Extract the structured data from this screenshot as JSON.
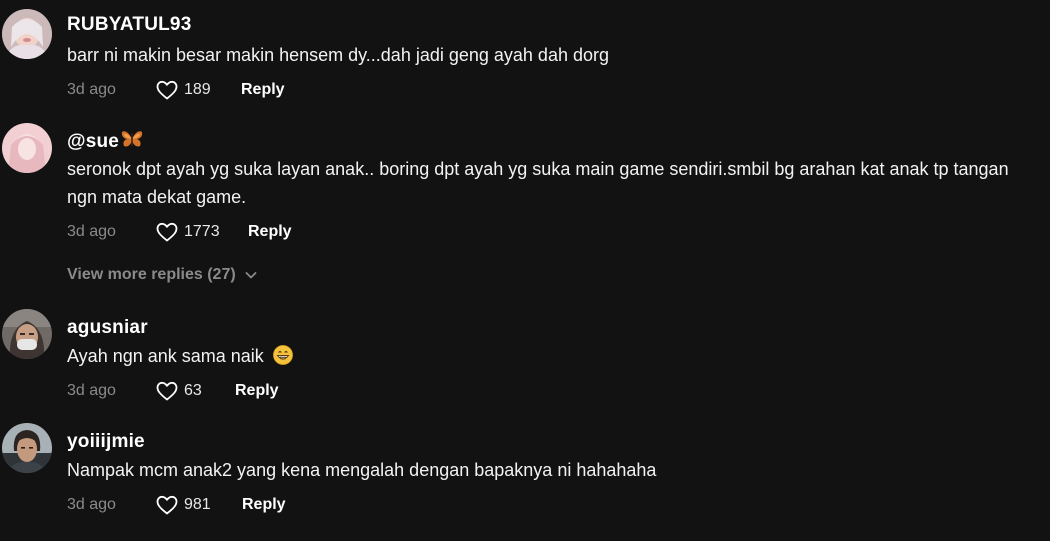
{
  "comments": [
    {
      "username": "RUBYATUL93",
      "text": "barr ni makin besar makin hensem dy...dah jadi geng ayah dah dorg",
      "time": "3d ago",
      "likes": "189",
      "reply_label": "Reply"
    },
    {
      "username": "@sue",
      "username_emoji": "butterfly-emoji",
      "text": "seronok dpt ayah yg suka layan anak.. boring dpt ayah yg suka main game sendiri.smbil bg arahan kat anak tp tangan ngn mata dekat game.",
      "time": "3d ago",
      "likes": "1773",
      "reply_label": "Reply",
      "view_more": "View more replies (27)"
    },
    {
      "username": "agusniar",
      "text": "Ayah ngn ank sama naik",
      "text_emoji": "grinning-face-emoji",
      "time": "3d ago",
      "likes": "63",
      "reply_label": "Reply"
    },
    {
      "username": "yoiiijmie",
      "text": "Nampak mcm anak2 yang kena mengalah dengan bapaknya ni hahahaha",
      "time": "3d ago",
      "likes": "981",
      "reply_label": "Reply"
    }
  ],
  "icons": {
    "like": "heart-outline-icon",
    "expand": "chevron-down-icon"
  },
  "colors": {
    "background": "#121212",
    "primary_text": "#ffffff",
    "secondary_text": "#8a8a8a"
  }
}
